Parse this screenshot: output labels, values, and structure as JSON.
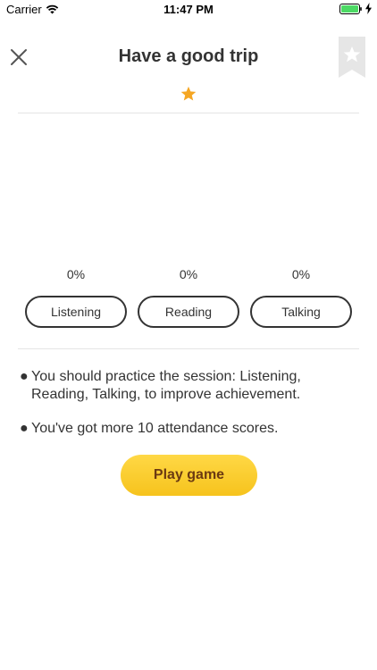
{
  "status_bar": {
    "carrier": "Carrier",
    "time": "11:47 PM",
    "battery_color": "#4cd964",
    "icons": [
      "wifi-icon",
      "battery-icon",
      "charging-bolt-icon"
    ]
  },
  "header": {
    "title": "Have a good trip",
    "close_icon": "close-icon",
    "bookmark_icon": "bookmark-star-icon"
  },
  "rating": {
    "stars": 1,
    "star_color": "#f5a623"
  },
  "skills": [
    {
      "label": "Listening",
      "percent": "0%"
    },
    {
      "label": "Reading",
      "percent": "0%"
    },
    {
      "label": "Talking",
      "percent": "0%"
    }
  ],
  "messages": [
    {
      "bullet": "●",
      "text": "You should practice the session:  Listening, Reading, Talking, to improve achievement."
    },
    {
      "bullet": "●",
      "text": "You've got more 10 attendance scores."
    }
  ],
  "play_button": {
    "label": "Play game",
    "color": "#fdd02c"
  }
}
